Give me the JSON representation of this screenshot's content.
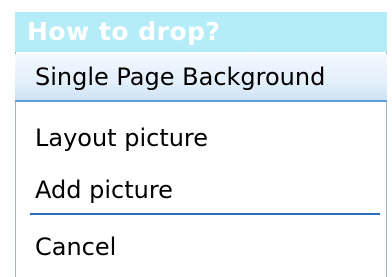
{
  "menu": {
    "title": "How to drop?",
    "items": [
      {
        "label": "Single Page Background",
        "selected": true
      },
      {
        "label": "Layout picture",
        "selected": false
      },
      {
        "label": "Add picture",
        "selected": false
      },
      {
        "label": "Cancel",
        "selected": false
      }
    ]
  },
  "colors": {
    "header_bg": "#b4ecf8",
    "header_text": "#ffffff",
    "selected_border": "#5f9fd6",
    "separator": "#2c6fb7",
    "frame_border": "#9ab8d4"
  }
}
